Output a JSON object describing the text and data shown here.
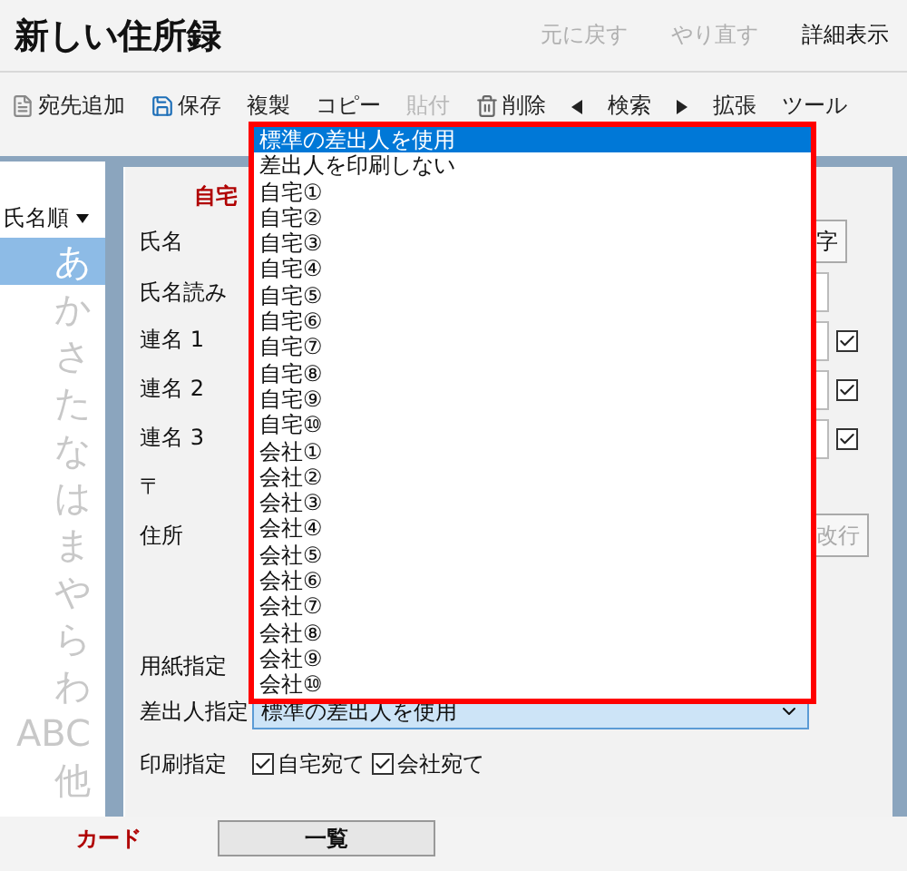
{
  "window": {
    "title": "新しい住所録"
  },
  "header_actions": [
    {
      "label": "元に戻す",
      "disabled": true
    },
    {
      "label": "やり直す",
      "disabled": true
    },
    {
      "label": "詳細表示",
      "disabled": false
    }
  ],
  "toolbar": [
    {
      "kind": "document",
      "label": "宛先追加",
      "disabled": false
    },
    {
      "kind": "save",
      "label": "保存",
      "disabled": false
    },
    {
      "kind": "button",
      "label": "複製",
      "disabled": false
    },
    {
      "kind": "button",
      "label": "コピー",
      "disabled": false
    },
    {
      "kind": "button",
      "label": "貼付",
      "disabled": true
    },
    {
      "kind": "trash",
      "label": "削除",
      "disabled": false
    },
    {
      "kind": "prev"
    },
    {
      "kind": "button",
      "label": "検索",
      "disabled": false
    },
    {
      "kind": "next"
    },
    {
      "kind": "button",
      "label": "拡張",
      "disabled": false
    },
    {
      "kind": "button",
      "label": "ツール",
      "disabled": false
    }
  ],
  "sidebar": {
    "sort_label": "氏名順",
    "index": [
      {
        "label": "あ",
        "selected": true
      },
      {
        "label": "か",
        "selected": false
      },
      {
        "label": "さ",
        "selected": false
      },
      {
        "label": "た",
        "selected": false
      },
      {
        "label": "な",
        "selected": false
      },
      {
        "label": "は",
        "selected": false
      },
      {
        "label": "ま",
        "selected": false
      },
      {
        "label": "や",
        "selected": false
      },
      {
        "label": "ら",
        "selected": false
      },
      {
        "label": "わ",
        "selected": false
      },
      {
        "label": "ABC",
        "selected": false
      },
      {
        "label": "他",
        "selected": false
      }
    ]
  },
  "form": {
    "section": "自宅",
    "rows": [
      {
        "kind": "name",
        "label": "氏名",
        "button": {
          "label": "字",
          "disabled": false
        }
      },
      {
        "kind": "text",
        "label": "氏名読み"
      },
      {
        "kind": "text_check",
        "label": "連名 1",
        "checked": true
      },
      {
        "kind": "text_check",
        "label": "連名 2",
        "checked": true
      },
      {
        "kind": "text_check",
        "label": "連名 3",
        "checked": true
      },
      {
        "kind": "zip",
        "label": "〒"
      },
      {
        "kind": "address",
        "label": "住所",
        "button": {
          "label": "改行",
          "disabled": true
        }
      },
      {
        "kind": "paper",
        "label": "用紙指定"
      },
      {
        "kind": "sender",
        "label": "差出人指定",
        "value": "標準の差出人を使用"
      },
      {
        "kind": "print",
        "label": "印刷指定",
        "options": [
          {
            "label": "自宅宛て",
            "checked": true
          },
          {
            "label": "会社宛て",
            "checked": true
          }
        ]
      }
    ]
  },
  "sender_options": [
    {
      "label": "標準の差出人を使用",
      "selected": true
    },
    {
      "label": "差出人を印刷しない",
      "selected": false
    },
    {
      "label": "自宅①",
      "selected": false
    },
    {
      "label": "自宅②",
      "selected": false
    },
    {
      "label": "自宅③",
      "selected": false
    },
    {
      "label": "自宅④",
      "selected": false
    },
    {
      "label": "自宅⑤",
      "selected": false
    },
    {
      "label": "自宅⑥",
      "selected": false
    },
    {
      "label": "自宅⑦",
      "selected": false
    },
    {
      "label": "自宅⑧",
      "selected": false
    },
    {
      "label": "自宅⑨",
      "selected": false
    },
    {
      "label": "自宅⑩",
      "selected": false
    },
    {
      "label": "会社①",
      "selected": false
    },
    {
      "label": "会社②",
      "selected": false
    },
    {
      "label": "会社③",
      "selected": false
    },
    {
      "label": "会社④",
      "selected": false
    },
    {
      "label": "会社⑤",
      "selected": false
    },
    {
      "label": "会社⑥",
      "selected": false
    },
    {
      "label": "会社⑦",
      "selected": false
    },
    {
      "label": "会社⑧",
      "selected": false
    },
    {
      "label": "会社⑨",
      "selected": false
    },
    {
      "label": "会社⑩",
      "selected": false
    }
  ],
  "tabs": [
    {
      "label": "カード",
      "selected": true
    },
    {
      "label": "一覧",
      "selected": false
    }
  ]
}
